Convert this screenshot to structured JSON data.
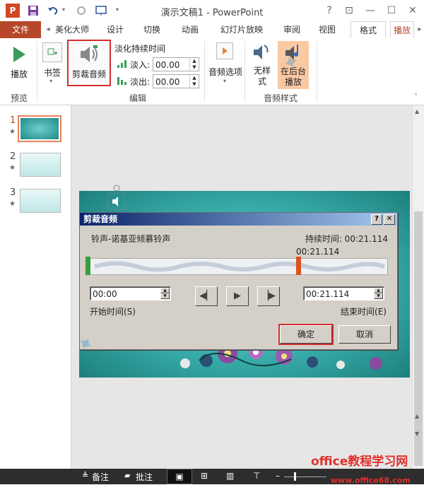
{
  "window": {
    "title": "演示文稿1 - PowerPoint"
  },
  "tabs": [
    {
      "label": "文件"
    },
    {
      "label": "美化大师"
    },
    {
      "label": "设计"
    },
    {
      "label": "切换"
    },
    {
      "label": "动画"
    },
    {
      "label": "幻灯片放映"
    },
    {
      "label": "审阅"
    },
    {
      "label": "视图"
    },
    {
      "label": "格式"
    },
    {
      "label": "播放"
    }
  ],
  "ribbon": {
    "play_label": "播放",
    "bookmark_label": "书签",
    "trim_label": "剪裁音频",
    "fade_title": "淡化持续时间",
    "fade_in_label": "淡入:",
    "fade_in_value": "00.00",
    "fade_out_label": "淡出:",
    "fade_out_value": "00.00",
    "audio_options_label": "音频选项",
    "no_style_label": "无样式",
    "bg_play_label": "在后台播放",
    "group_preview": "预览",
    "group_edit": "编辑",
    "group_audio_style": "音频样式"
  },
  "slides": [
    {
      "num": "1",
      "star": "★"
    },
    {
      "num": "2",
      "star": "★"
    },
    {
      "num": "3",
      "star": "★"
    }
  ],
  "dialog": {
    "title": "剪裁音频",
    "help": "?",
    "close": "✕",
    "file_name": "铃声-诺基亚倾慕铃声",
    "duration": "持续时间: 00:21.114",
    "marker_time": "00:21.114",
    "start_value": "00:00",
    "start_label": "开始时间(S)",
    "end_value": "00:21.114",
    "end_label": "结束时间(E)",
    "ok": "确定",
    "cancel": "取消"
  },
  "status": {
    "notes": "备注",
    "comments": "批注",
    "zoom": "+"
  },
  "watermark": {
    "site": "office教程学习网",
    "url": "www.office68.com"
  },
  "colors": {
    "accent": "#b7472a",
    "slide_teal": "#2fa5a3",
    "highlight": "#d32f2f"
  }
}
